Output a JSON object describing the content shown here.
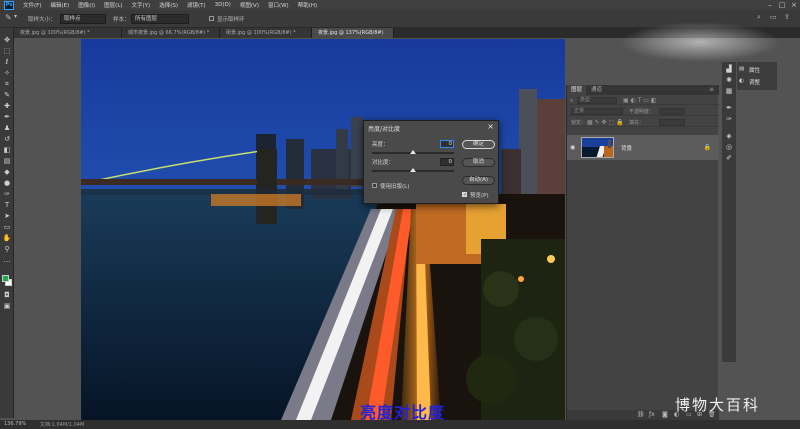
{
  "app": {
    "logo": "Ps",
    "menu": [
      "文件(F)",
      "编辑(E)",
      "图像(I)",
      "图层(L)",
      "文字(Y)",
      "选择(S)",
      "滤镜(T)",
      "3D(D)",
      "视图(V)",
      "窗口(W)",
      "帮助(H)"
    ]
  },
  "options": {
    "sample_size_label": "取样大小：",
    "sample_size_value": "取样点",
    "sample_label": "样本：",
    "sample_value": "所有图层",
    "show_ring_label": "显示取样环"
  },
  "tabs": [
    {
      "label": "夜景.jpg @ 100%(RGB/8#) *",
      "active": false
    },
    {
      "label": "城市夜景.jpg @ 66.7%(RGB/8#) *",
      "active": false
    },
    {
      "label": "街景.jpg @ 100%(RGB/8#) *",
      "active": false
    },
    {
      "label": "夜景.jpg @ 137%(RGB/8#)",
      "active": true
    }
  ],
  "tools": [
    "move-icon",
    "marquee-icon",
    "lasso-icon",
    "quick-select-icon",
    "crop-icon",
    "eyedropper-icon",
    "healing-icon",
    "brush-icon",
    "stamp-icon",
    "history-brush-icon",
    "eraser-icon",
    "gradient-icon",
    "blur-icon",
    "dodge-icon",
    "pen-icon",
    "type-icon",
    "path-select-icon",
    "shape-icon",
    "hand-icon",
    "zoom-icon",
    "more-icon"
  ],
  "colors": {
    "foreground": "#1fa84a",
    "background": "#ffffff",
    "caption": "#2323d8",
    "focus": "#2d8ceb"
  },
  "dialog": {
    "title": "亮度/对比度",
    "close": "×",
    "brightness_label": "亮度：",
    "brightness_value": "0",
    "contrast_label": "对比度：",
    "contrast_value": "0",
    "ok": "确定",
    "cancel": "取消",
    "auto": "自动(A)",
    "legacy_label": "使用旧版(L)",
    "legacy_checked": false,
    "preview_label": "预览(P)",
    "preview_checked": true
  },
  "layers_panel": {
    "tabs": [
      "图层",
      "通道"
    ],
    "kind_label": "类型",
    "mode_label": "正常",
    "opacity_label": "不透明度：",
    "lock_label": "锁定：",
    "fill_label": "填充：",
    "layer_name": "背景"
  },
  "properties": {
    "items": [
      "属性",
      "调整"
    ]
  },
  "status": {
    "zoom": "136.79%",
    "doc": "文档:1.04M/1.04M"
  },
  "caption": "亮度对比度",
  "watermark": "博物大百科"
}
